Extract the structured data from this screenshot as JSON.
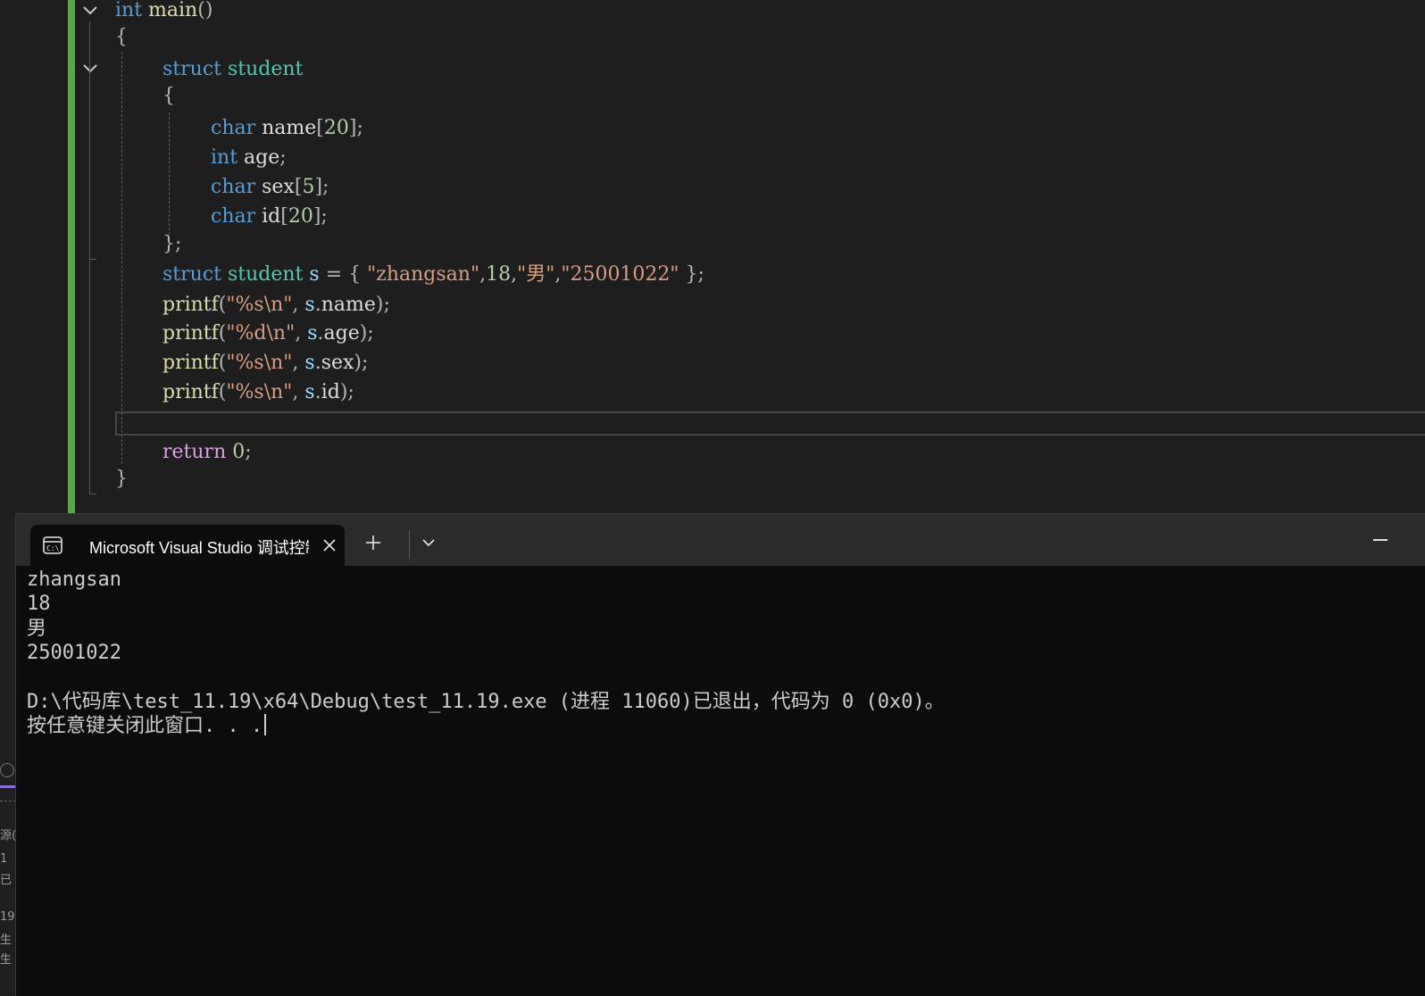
{
  "editor": {
    "lines": [
      [
        [
          "kw",
          "int"
        ],
        [
          "punc",
          " "
        ],
        [
          "fn",
          "main"
        ],
        [
          "punc",
          "()"
        ]
      ],
      [
        [
          "punc",
          "{"
        ]
      ],
      [
        [
          "kw",
          "struct"
        ],
        [
          "punc",
          " "
        ],
        [
          "type",
          "student"
        ]
      ],
      [
        [
          "punc",
          "{"
        ]
      ],
      [
        [
          "kw",
          "char"
        ],
        [
          "punc",
          " "
        ],
        [
          "plain",
          "name"
        ],
        [
          "punc",
          "["
        ],
        [
          "num",
          "20"
        ],
        [
          "punc",
          "];"
        ]
      ],
      [
        [
          "kw",
          "int"
        ],
        [
          "punc",
          " "
        ],
        [
          "plain",
          "age"
        ],
        [
          "punc",
          ";"
        ]
      ],
      [
        [
          "kw",
          "char"
        ],
        [
          "punc",
          " "
        ],
        [
          "plain",
          "sex"
        ],
        [
          "punc",
          "["
        ],
        [
          "num",
          "5"
        ],
        [
          "punc",
          "];"
        ]
      ],
      [
        [
          "kw",
          "char"
        ],
        [
          "punc",
          " "
        ],
        [
          "plain",
          "id"
        ],
        [
          "punc",
          "["
        ],
        [
          "num",
          "20"
        ],
        [
          "punc",
          "];"
        ]
      ],
      [
        [
          "punc",
          "};"
        ]
      ],
      [
        [
          "kw",
          "struct"
        ],
        [
          "punc",
          " "
        ],
        [
          "type",
          "student"
        ],
        [
          "punc",
          " "
        ],
        [
          "var",
          "s"
        ],
        [
          "punc",
          " = { "
        ],
        [
          "str",
          "\"zhangsan\""
        ],
        [
          "punc",
          ","
        ],
        [
          "num",
          "18"
        ],
        [
          "punc",
          ","
        ],
        [
          "str",
          "\"男\""
        ],
        [
          "punc",
          ","
        ],
        [
          "str",
          "\"25001022\""
        ],
        [
          "punc",
          " };"
        ]
      ],
      [
        [
          "fn",
          "printf"
        ],
        [
          "punc",
          "("
        ],
        [
          "str",
          "\"%s\\n\""
        ],
        [
          "punc",
          ", "
        ],
        [
          "var",
          "s"
        ],
        [
          "punc",
          "."
        ],
        [
          "plain",
          "name"
        ],
        [
          "punc",
          ");"
        ]
      ],
      [
        [
          "fn",
          "printf"
        ],
        [
          "punc",
          "("
        ],
        [
          "str",
          "\"%d\\n\""
        ],
        [
          "punc",
          ", "
        ],
        [
          "var",
          "s"
        ],
        [
          "punc",
          "."
        ],
        [
          "plain",
          "age"
        ],
        [
          "punc",
          ");"
        ]
      ],
      [
        [
          "fn",
          "printf"
        ],
        [
          "punc",
          "("
        ],
        [
          "str",
          "\"%s\\n\""
        ],
        [
          "punc",
          ", "
        ],
        [
          "var",
          "s"
        ],
        [
          "punc",
          "."
        ],
        [
          "plain",
          "sex"
        ],
        [
          "punc",
          ");"
        ]
      ],
      [
        [
          "fn",
          "printf"
        ],
        [
          "punc",
          "("
        ],
        [
          "str",
          "\"%s\\n\""
        ],
        [
          "punc",
          ", "
        ],
        [
          "var",
          "s"
        ],
        [
          "punc",
          "."
        ],
        [
          "plain",
          "id"
        ],
        [
          "punc",
          ");"
        ]
      ],
      [],
      [
        [
          "ctl",
          "return"
        ],
        [
          "punc",
          " "
        ],
        [
          "num",
          "0"
        ],
        [
          "punc",
          ";"
        ]
      ],
      [
        [
          "punc",
          "}"
        ]
      ]
    ]
  },
  "terminal": {
    "tab_title": "Microsoft Visual Studio 调试控制台",
    "output": [
      "zhangsan",
      "18",
      "男",
      "25001022",
      "",
      "D:\\代码库\\test_11.19\\x64\\Debug\\test_11.19.exe (进程 11060)已退出，代码为 0 (0x0)。",
      "按任意键关闭此窗口. . ."
    ]
  },
  "ghost_panel": {
    "fragments": [
      "源(",
      "1",
      "已",
      "19",
      "生",
      "生"
    ]
  },
  "icons": {
    "fold": "chevron-down-icon",
    "tab": "console-icon",
    "close": "close-icon",
    "new_tab": "plus-icon",
    "dropdown": "chevron-down-icon",
    "minimize": "minimize-icon"
  },
  "colors": {
    "keyword": "#569cd6",
    "type": "#4ec9b0",
    "function": "#dcdcaa",
    "string": "#d69d85",
    "number": "#b5cea8",
    "control": "#d8a0df",
    "change_bar": "#57a64a",
    "terminal_bg": "#0c0c0c"
  }
}
